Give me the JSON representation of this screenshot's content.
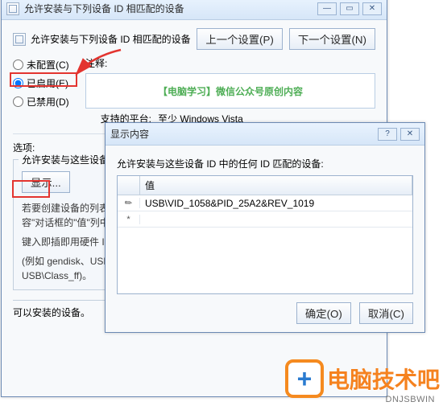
{
  "window": {
    "title": "允许安装与下列设备 ID 相匹配的设备"
  },
  "header": {
    "label": "允许安装与下列设备 ID 相匹配的设备"
  },
  "nav": {
    "prev": "上一个设置(P)",
    "next": "下一个设置(N)"
  },
  "radios": {
    "notes_label": "注释:",
    "unconfigured": "未配置(C)",
    "enabled": "已启用(E)",
    "disabled": "已禁用(D)"
  },
  "notes_content": "【电脑学习】微信公众号原创内容",
  "platform": {
    "label": "支持的平台:",
    "value": "至少 Windows Vista"
  },
  "options": {
    "label": "选项:",
    "group_title": "允许安装与这些设备 ID 中",
    "show_button": "显示...",
    "desc1": "若要创建设备的列表，请",
    "desc2": "容\"对话框的\"值\"列中",
    "desc3": "键入即插即用硬件 ID 或兼",
    "desc4": "(例如 gendisk、USB\\CO",
    "desc5": "USB\\Class_ff)。"
  },
  "help_lower": "可以安装的设备。",
  "dialog": {
    "title": "显示内容",
    "instruction": "允许安装与这些设备 ID 中的任何 ID 匹配的设备:",
    "col_value": "值",
    "row1_value": "USB\\VID_1058&PID_25A2&REV_1019",
    "row_new_marker": "*",
    "ok": "确定(O)",
    "cancel": "取消(C)"
  },
  "branding": {
    "text": "电脑技术吧",
    "url": "DNJSBWIN"
  }
}
